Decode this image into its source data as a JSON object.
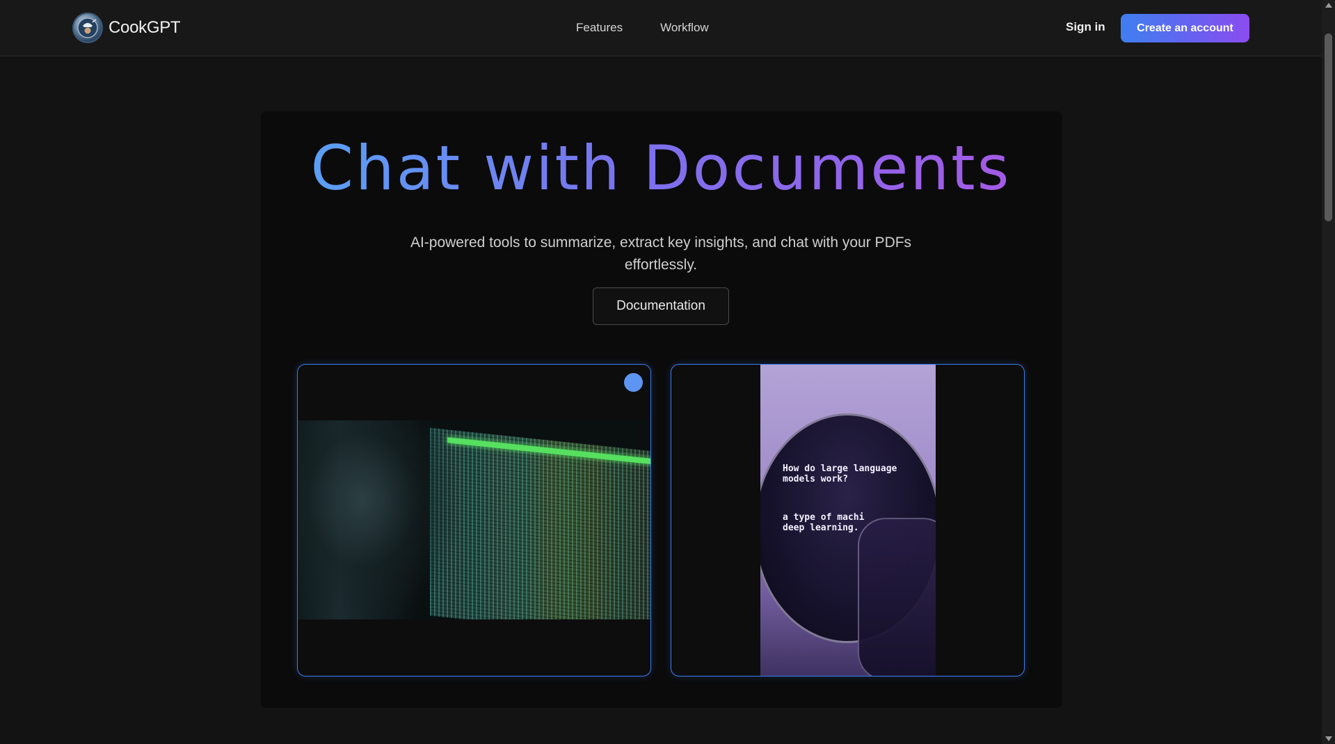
{
  "header": {
    "brand_name": "CookGPT",
    "nav": [
      {
        "label": "Features"
      },
      {
        "label": "Workflow"
      }
    ],
    "sign_in_label": "Sign in",
    "cta_label": "Create an account"
  },
  "hero": {
    "title": "Chat with Documents",
    "subtitle": "AI-powered tools to summarize, extract key insights, and chat with your PDFs effortlessly.",
    "doc_button_label": "Documentation"
  },
  "media": {
    "right_image_text_top": "How do large language\nmodels work?",
    "right_image_text_bottom": "a type of machi\ndeep learning."
  },
  "colors": {
    "accent_blue": "#3f7ff0",
    "accent_purple": "#8b4cf0",
    "background": "#131313"
  }
}
